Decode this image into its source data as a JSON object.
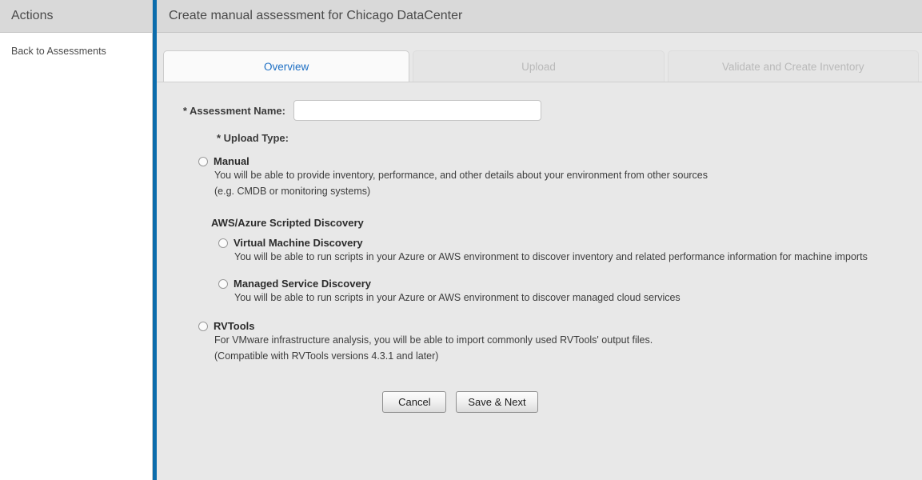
{
  "sidebar": {
    "header_title": "Actions",
    "links": [
      {
        "label": "Back to Assessments"
      }
    ]
  },
  "header": {
    "title": "Create manual assessment for Chicago DataCenter"
  },
  "tabs": [
    {
      "label": "Overview",
      "state": "active"
    },
    {
      "label": "Upload",
      "state": "disabled"
    },
    {
      "label": "Validate and Create Inventory",
      "state": "disabled"
    }
  ],
  "form": {
    "assessment_name": {
      "label": "* Assessment Name:",
      "value": "",
      "placeholder": ""
    },
    "upload_type": {
      "label": "* Upload Type:",
      "group_heading": "AWS/Azure Scripted Discovery",
      "options": [
        {
          "id": "manual",
          "title": "Manual",
          "desc_line1": "You will be able to provide inventory, performance, and other details about your environment from other sources",
          "desc_line2": "(e.g. CMDB or monitoring systems)",
          "selected": false
        },
        {
          "id": "virtual-machine-discovery",
          "title": "Virtual Machine Discovery",
          "desc_line1": "You will be able to run scripts in your Azure or AWS environment to discover inventory and related performance information for machine imports",
          "desc_line2": "",
          "selected": false
        },
        {
          "id": "managed-service-discovery",
          "title": "Managed Service Discovery",
          "desc_line1": "You will be able to run scripts in your Azure or AWS environment to discover managed cloud services",
          "desc_line2": "",
          "selected": false
        },
        {
          "id": "rvtools",
          "title": "RVTools",
          "desc_line1": "For VMware infrastructure analysis, you will be able to import commonly used RVTools' output files.",
          "desc_line2": "(Compatible with RVTools versions 4.3.1 and later)",
          "selected": false
        }
      ]
    }
  },
  "buttons": {
    "cancel": "Cancel",
    "save_next": "Save & Next"
  },
  "colors": {
    "accent_blue": "#0b6cac",
    "tab_active_text": "#1d6fc4",
    "page_bg": "#e8e8e8",
    "header_bg": "#d9d9d9"
  }
}
